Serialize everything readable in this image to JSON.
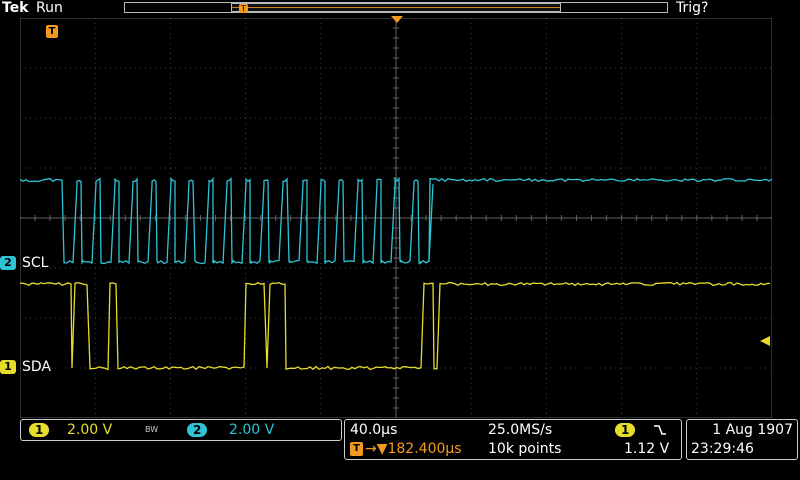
{
  "header": {
    "brand": "Tek",
    "acq_state": "Run",
    "trigger_state": "Trig?",
    "trigger_marker": "T"
  },
  "channels": [
    {
      "number": "2",
      "name": "SCL",
      "color": "#2ec4d6"
    },
    {
      "number": "1",
      "name": "SDA",
      "color": "#e8dc2a"
    }
  ],
  "readouts": {
    "ch1_number": "1",
    "ch1_scale": "2.00 V",
    "bw_icon": "BW",
    "ch2_number": "2",
    "ch2_scale": "2.00 V",
    "horizontal_scale": "40.0µs",
    "sample_rate": "25.0MS/s",
    "trigger_position": "→▼182.400µs",
    "record_length": "10k points",
    "trigger_source": "1",
    "trigger_slope_icon": "falling-edge",
    "trigger_level": "1.12 V",
    "date": "1 Aug 1907",
    "time": "23:29:46"
  },
  "colors": {
    "ch1": "#e8dc2a",
    "ch2": "#2ec4d6",
    "trigger": "#f39a1e",
    "graticule": "#4a4a4a"
  }
}
